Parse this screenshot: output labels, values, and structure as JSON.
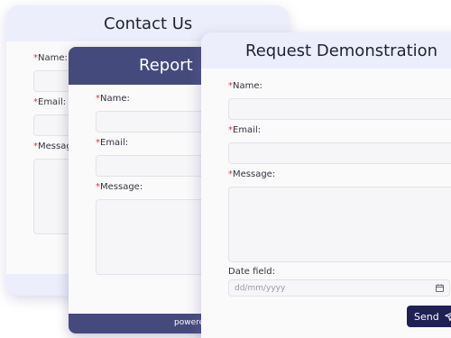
{
  "contact_form": {
    "title": "Contact Us",
    "name_label": "Name:",
    "email_label": "Email:",
    "message_label": "Message",
    "required_mark": "*"
  },
  "report_form": {
    "title": "Report",
    "name_label": "Name:",
    "email_label": "Email:",
    "message_label": "Message:",
    "required_mark": "*",
    "footer_text": "powere"
  },
  "request_form": {
    "title": "Request Demonstration",
    "name_label": "Name:",
    "email_label": "Email:",
    "message_label": "Message:",
    "date_label": "Date field:",
    "date_placeholder": "dd/mm/yyyy",
    "required_mark": "*",
    "send_label": "Send",
    "send_icon": "paper-plane-icon",
    "calendar_icon": "calendar-icon"
  },
  "colors": {
    "header_light": "#eceefb",
    "header_dark": "#454a7d",
    "required_mark": "#d2374f",
    "send_button": "#1f2155"
  }
}
